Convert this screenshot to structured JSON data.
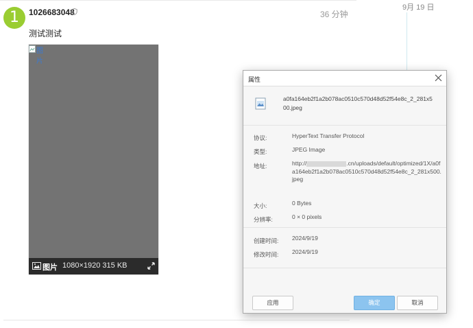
{
  "post": {
    "avatar_number": "1",
    "username": "1026683048",
    "time": "36 分钟",
    "text": "测试测试",
    "broken_image_alt": "图片",
    "lightbox_filename": "图片",
    "lightbox_info": "1080×1920 315 KB"
  },
  "timeline": {
    "date": "9月 19 日"
  },
  "dialog": {
    "title": "属性",
    "file_name": "a0fa164eb2f1a2b078ac0510c570d48d52f54e8c_2_281x500.jpeg",
    "protocol_label": "协议:",
    "protocol_value": "HyperText Transfer Protocol",
    "type_label": "类型:",
    "type_value": "JPEG Image",
    "address_label": "地址:",
    "address_prefix": "http://",
    "address_rest": ".cn/uploads/default/optimized/1X/a0fa164eb2f1a2b078ac0510c570d48d52f54e8c_2_281x500.jpeg",
    "size_label": "大小:",
    "size_value": "0 Bytes",
    "resolution_label": "分辨率:",
    "resolution_value": "0 × 0 pixels",
    "created_label": "创建时间:",
    "created_value": "2024/9/19",
    "modified_label": "修改时间:",
    "modified_value": "2024/9/19",
    "apply_button": "应用",
    "ok_button": "确定",
    "cancel_button": "取消"
  },
  "colors": {
    "avatar": "#9acd32",
    "ok_button": "#8cc4ef",
    "link": "#3a7bd5"
  }
}
